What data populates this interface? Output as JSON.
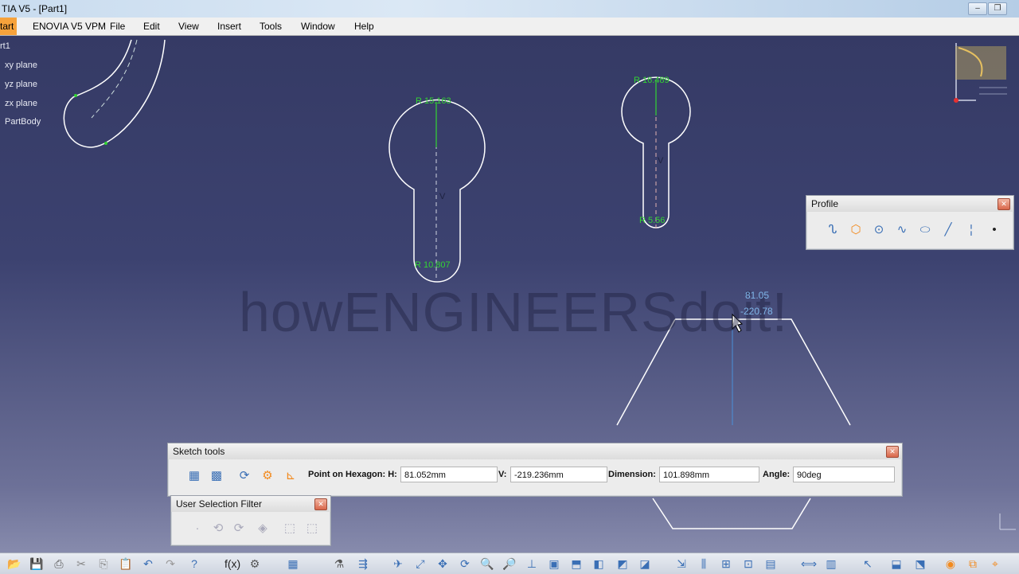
{
  "window": {
    "title": "TIA V5 - [Part1]"
  },
  "menu": {
    "items": [
      "tart",
      "ENOVIA V5 VPM",
      "File",
      "Edit",
      "View",
      "Insert",
      "Tools",
      "Window",
      "Help"
    ]
  },
  "tree": {
    "items": [
      "rt1",
      "xy plane",
      "yz plane",
      "zx plane",
      "PartBody"
    ]
  },
  "canvas": {
    "watermark": "howENGINEERSdoit!",
    "cursor_coord_h": "81.05",
    "cursor_coord_v": "-220.78",
    "dim_labels": [
      "R 15.163",
      "R 10.807",
      "R 16.489",
      "R 5.56"
    ],
    "constraint_mark": "V"
  },
  "profile_toolbar": {
    "title": "Profile",
    "icons": [
      "profile-icon",
      "hexagon-icon",
      "circle-icon",
      "spline-icon",
      "ellipse-icon",
      "line-icon",
      "axis-icon",
      "point-icon"
    ]
  },
  "sketch_tools": {
    "title": "Sketch tools",
    "point_label": "Point on Hexagon: H:",
    "h_value": "81.052mm",
    "v_label": "V:",
    "v_value": "-219.236mm",
    "dimension_label": "Dimension:",
    "dimension_value": "101.898mm",
    "angle_label": "Angle:",
    "angle_value": "90deg"
  },
  "user_selection_filter": {
    "title": "User Selection Filter"
  },
  "colors": {
    "background_top": "#343963",
    "background_bottom": "#8f93b3",
    "sketch_line": "#ffffff",
    "constraint": "#33d433",
    "accent_orange": "#f6a23b"
  }
}
